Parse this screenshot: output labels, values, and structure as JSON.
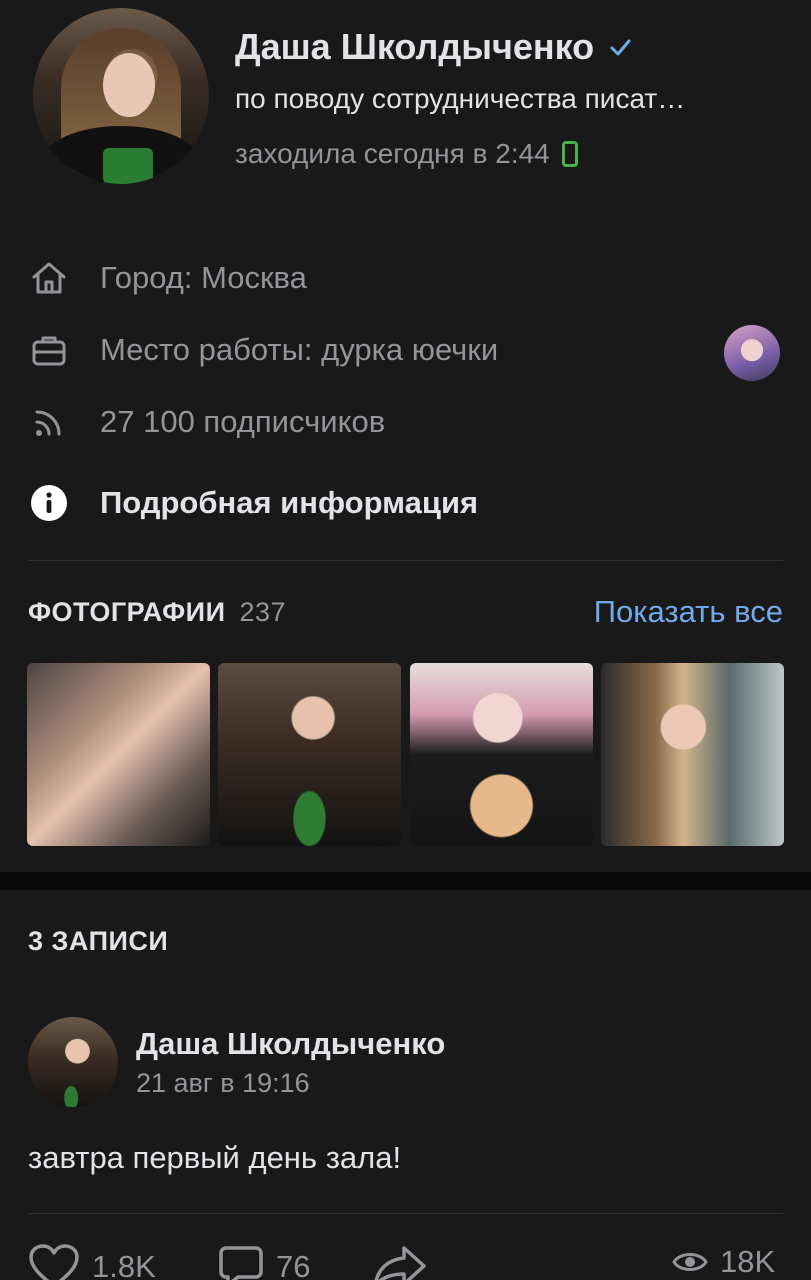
{
  "profile": {
    "name": "Даша Школдыченко",
    "status": "по поводу сотрудничества писат…",
    "last_seen": "заходила сегодня в 2:44"
  },
  "info": {
    "city": "Город: Москва",
    "work": "Место работы: дурка юечки",
    "followers": "27 100 подписчиков",
    "details": "Подробная информация"
  },
  "photos": {
    "title": "ФОТОГРАФИИ",
    "count": "237",
    "show_all": "Показать все"
  },
  "posts": {
    "title": "3 ЗАПИСИ",
    "author": "Даша Школдыченко",
    "date": "21 авг в 19:16",
    "text": "завтра первый день зала!",
    "likes": "1.8K",
    "comments": "76",
    "views": "18K"
  },
  "colors": {
    "background": "#19191a",
    "accent": "#71aaeb",
    "secondary_text": "#939599",
    "online_green": "#4bb34b"
  },
  "icons": [
    "verified-check-icon",
    "mobile-online-icon",
    "home-icon",
    "briefcase-icon",
    "rss-icon",
    "info-icon",
    "heart-icon",
    "comment-icon",
    "share-icon",
    "eye-icon"
  ]
}
